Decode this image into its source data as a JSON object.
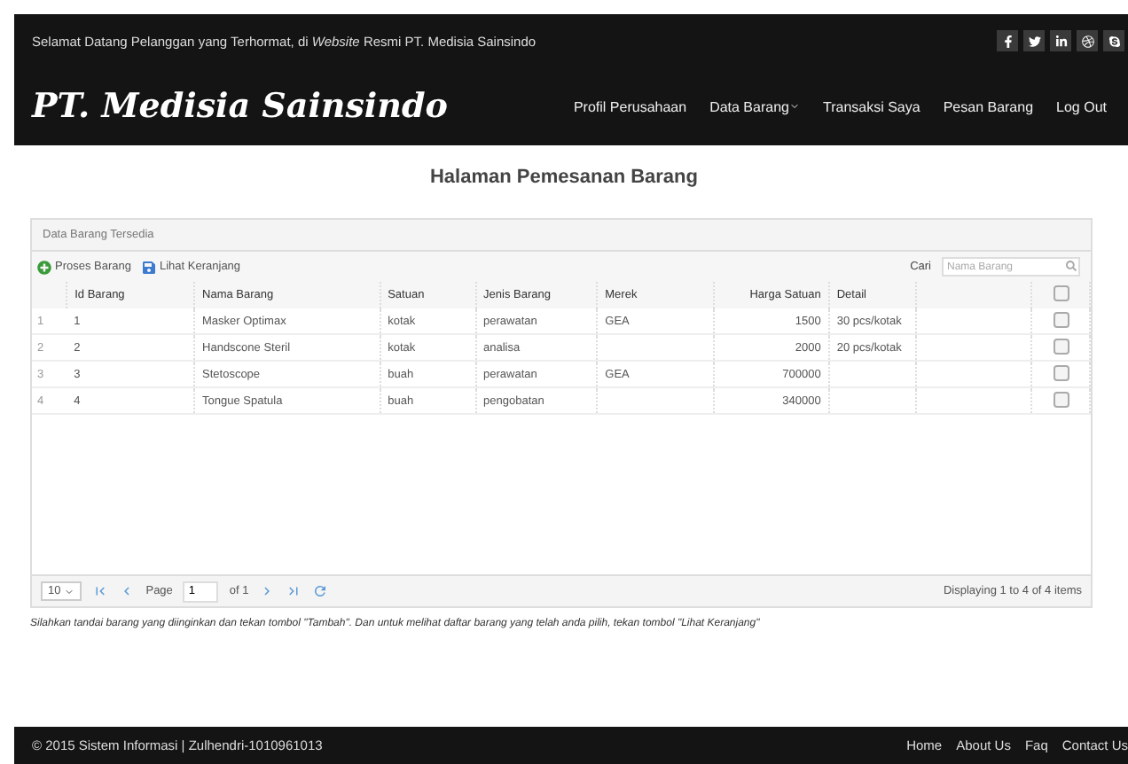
{
  "top_bar": {
    "welcome": "Selamat Datang Pelanggan yang Terhormat, di *Website* Resmi PT. Medisia Sainsindo"
  },
  "nav": {
    "logo": "PT. Medisia Sainsindo",
    "items": [
      {
        "label": "Profil Perusahaan",
        "dropdown": false
      },
      {
        "label": "Data Barang",
        "dropdown": true
      },
      {
        "label": "Transaksi Saya",
        "dropdown": false
      },
      {
        "label": "Pesan Barang",
        "dropdown": false
      },
      {
        "label": "Log Out",
        "dropdown": false
      }
    ]
  },
  "page_title": "Halaman Pemesanan Barang",
  "panel": {
    "title": "Data Barang Tersedia",
    "toolbar": [
      {
        "label": "Proses Barang",
        "kind": "add"
      },
      {
        "label": "Lihat Keranjang",
        "kind": "save"
      }
    ],
    "search": {
      "label": "Cari",
      "placeholder": "Nama Barang"
    },
    "columns": [
      {
        "label": "Id Barang",
        "kind": "text"
      },
      {
        "label": "Nama Barang",
        "kind": "text"
      },
      {
        "label": "Satuan",
        "kind": "text"
      },
      {
        "label": "Jenis Barang",
        "kind": "text"
      },
      {
        "label": "Merek",
        "kind": "text"
      },
      {
        "label": "Harga Satuan",
        "kind": "number"
      },
      {
        "label": "Detail",
        "kind": "text"
      }
    ],
    "header_checked": false,
    "rows": [
      {
        "number": "1",
        "cells": [
          "1",
          "Masker Optimax",
          "kotak",
          "perawatan",
          "GEA",
          "1500",
          "30 pcs/kotak"
        ],
        "checked": false
      },
      {
        "number": "2",
        "cells": [
          "2",
          "Handscone Steril",
          "kotak",
          "analisa",
          "",
          "2000",
          "20 pcs/kotak"
        ],
        "checked": false
      },
      {
        "number": "3",
        "cells": [
          "3",
          "Stetoscope",
          "buah",
          "perawatan",
          "GEA",
          "700000",
          ""
        ],
        "checked": false
      },
      {
        "number": "4",
        "cells": [
          "4",
          "Tongue Spatula",
          "buah",
          "pengobatan",
          "",
          "340000",
          ""
        ],
        "checked": false
      }
    ],
    "pager": {
      "page_size": "10",
      "page_label": "Page",
      "page": "1",
      "of": "of 1",
      "info": "Displaying 1 to 4 of 4 items"
    }
  },
  "note": "Silahkan tandai barang yang diinginkan dan tekan tombol \"Tambah\". Dan untuk melihat daftar barang yang telah anda pilih, tekan tombol \"Lihat Keranjang\"",
  "footer": {
    "copyright": "© 2015 Sistem Informasi | Zulhendri-1010961013",
    "links": [
      "Home",
      "About Us",
      "Faq",
      "Contact Us"
    ]
  }
}
